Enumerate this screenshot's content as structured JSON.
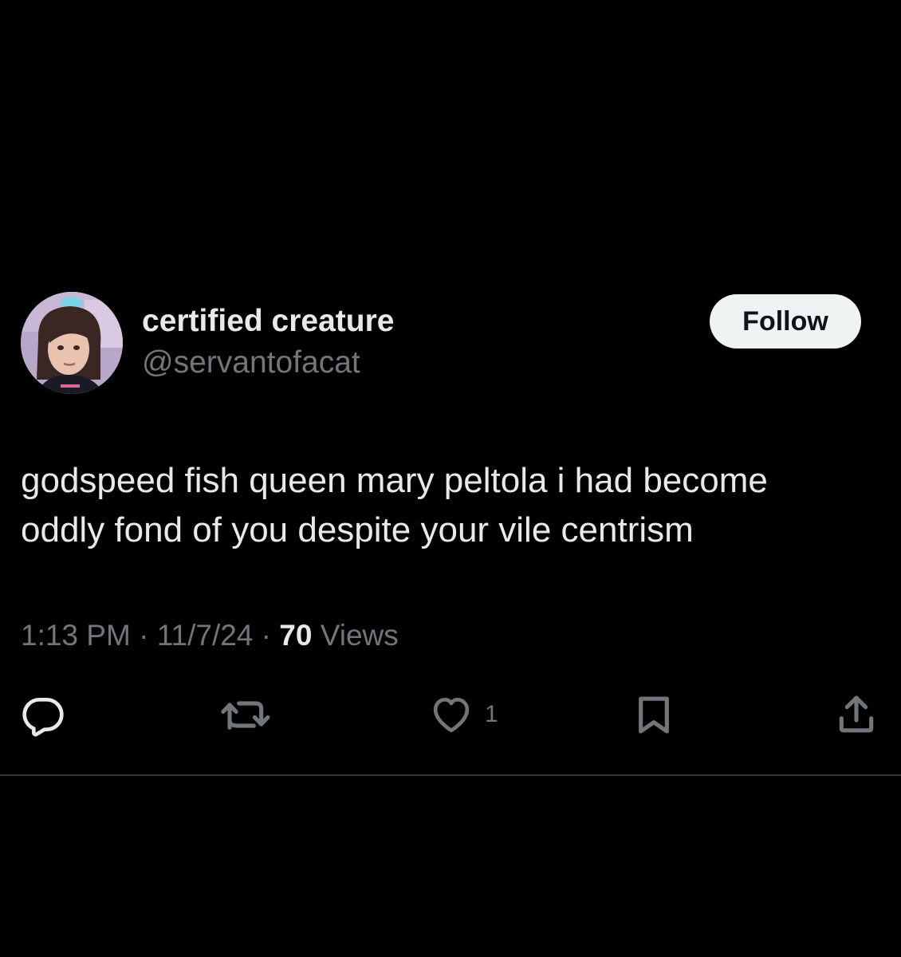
{
  "user": {
    "display_name": "certified creature",
    "handle": "@servantofacat",
    "avatar_icon": "profile-photo"
  },
  "follow_button": {
    "label": "Follow"
  },
  "tweet": {
    "lines": [
      "godspeed fish queen mary peltola i had become",
      "oddly fond of you despite your vile centrism"
    ]
  },
  "meta": {
    "time": "1:13 PM",
    "separator": "·",
    "date": "11/7/24",
    "views_count": "70",
    "views_label": "Views"
  },
  "actions": {
    "reply_icon": "speech-bubble-icon",
    "retweet_icon": "retweet-icon",
    "like_icon": "heart-icon",
    "like_count": "1",
    "bookmark_icon": "bookmark-icon",
    "share_icon": "share-icon"
  },
  "colors": {
    "background": "#000000",
    "primary_text": "#e7e9ea",
    "secondary_text": "#71767b",
    "follow_bg": "#eff3f4",
    "follow_text": "#0f1419",
    "divider": "#2f3336"
  }
}
